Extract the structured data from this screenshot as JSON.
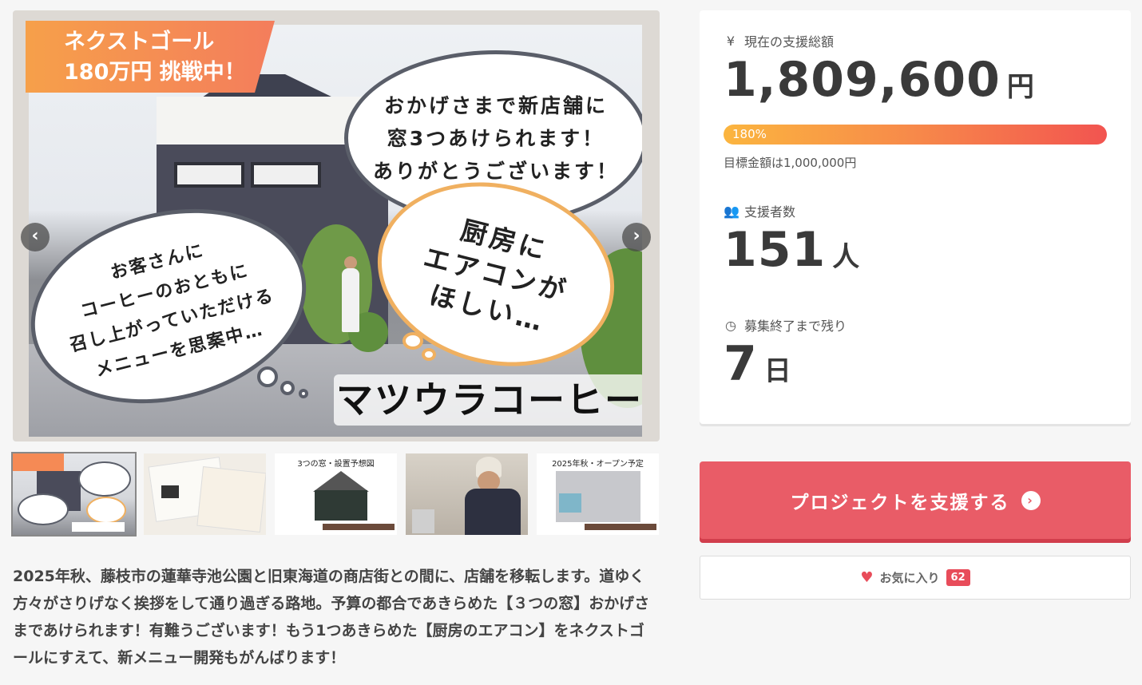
{
  "hero": {
    "ribbon_line1": "ネクストゴール",
    "ribbon_line2": "180万円 挑戦中！",
    "bubble_top": [
      "おかげさまで新店舗に",
      "窓3つあけられます！",
      "ありがとうございます！"
    ],
    "bubble_ac": [
      "厨房に",
      "エアコンが",
      "ほしい…"
    ],
    "bubble_left": [
      "お客さんに",
      "コーヒーのおともに",
      "召し上がっていただける",
      "メニューを思案中…"
    ],
    "logo": "マツウラコーヒー",
    "prev_icon": "‹",
    "next_icon": "›"
  },
  "thumbnails": [
    {
      "caption": ""
    },
    {
      "caption": ""
    },
    {
      "caption": "3つの窓・設置予想図"
    },
    {
      "caption": ""
    },
    {
      "caption": "2025年秋・オープン予定"
    }
  ],
  "description": "2025年秋、藤枝市の蓮華寺池公園と旧東海道の商店街との間に、店舗を移転します。道ゆく方々がさりげなく挨拶をして通り過ぎる路地。予算の都合であきらめた【３つの窓】おかげさまであけられます！有難うございます！もう1つあきらめた【厨房のエアコン】をネクストゴールにすえて、新メニュー開発もがんばります！",
  "stats": {
    "total": {
      "icon": "yen-icon",
      "icon_char": "¥",
      "label": "現在の支援総額",
      "value": "1,809,600",
      "unit": "円"
    },
    "progress": {
      "percent_text": "180%",
      "percent": 180
    },
    "goal_text": "目標金額は1,000,000円",
    "supporters": {
      "icon": "users-icon",
      "icon_char": "👥",
      "label": "支援者数",
      "value": "151",
      "unit": "人"
    },
    "remaining": {
      "icon": "clock-icon",
      "icon_char": "◷",
      "label": "募集終了まで残り",
      "value": "7",
      "unit": "日"
    }
  },
  "actions": {
    "support_label": "プロジェクトを支援する",
    "support_icon": "›",
    "favorite_label": "お気に入り",
    "favorite_count": "62",
    "favorite_icon": "♥"
  },
  "colors": {
    "accent": "#e95c67",
    "progress_start": "#fbb53f",
    "progress_end": "#f25450",
    "ribbon": "#f6a04a"
  }
}
